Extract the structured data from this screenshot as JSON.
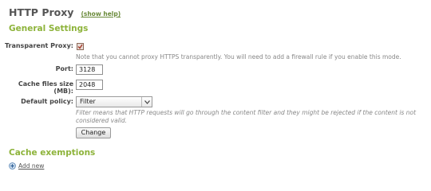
{
  "header": {
    "title": "HTTP Proxy",
    "help_link": "(show help)"
  },
  "general": {
    "section_title": "General Settings",
    "transparent_label": "Transparent Proxy:",
    "transparent_checked": true,
    "transparent_note": "Note that you cannot proxy HTTPS transparently. You will need to add a firewall rule if you enable this mode.",
    "port_label": "Port:",
    "port_value": "3128",
    "cache_label": "Cache files size (MB):",
    "cache_value": "2048",
    "policy_label": "Default policy:",
    "policy_value": "Filter",
    "policy_note_line1": "Filter means that HTTP requests will go through the content filter and they might be rejected if the content is not",
    "policy_note_line2": "considered valid.",
    "change_button": "Change"
  },
  "exemptions": {
    "section_title": "Cache exemptions",
    "add_new": "Add new"
  },
  "icons": {
    "checkbox_check": "check-icon",
    "dropdown": "chevron-down-icon",
    "add": "add-icon"
  },
  "colors": {
    "section_title": "#8db33a",
    "help_link": "#6a8a3a",
    "checkbox_fill": "#e9dcd6",
    "check_mark": "#a33a2a"
  }
}
